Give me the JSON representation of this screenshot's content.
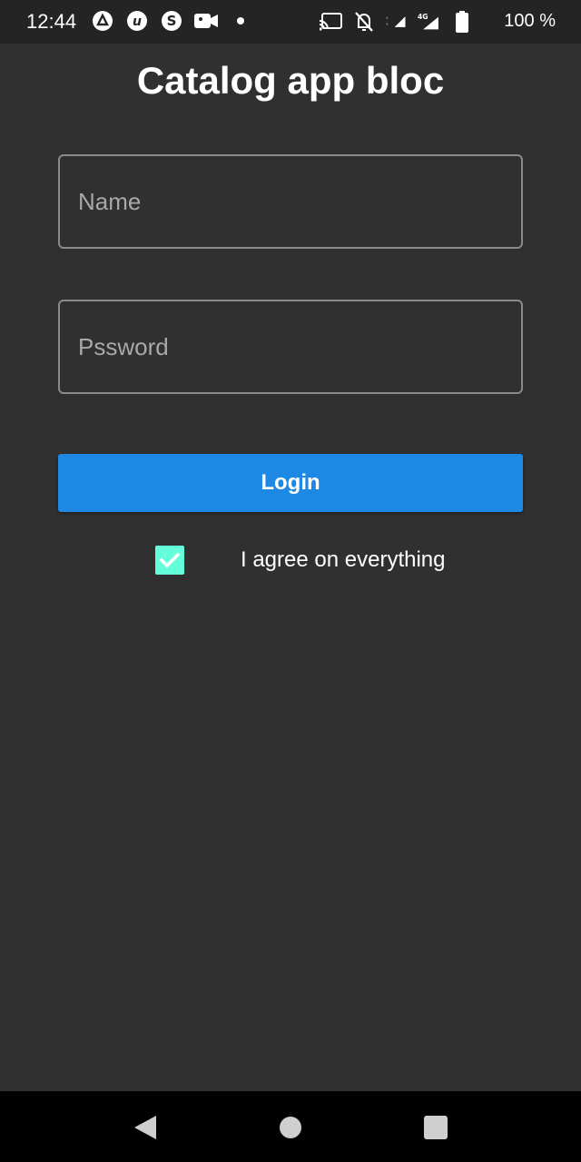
{
  "status_bar": {
    "time": "12:44",
    "battery": "100 %",
    "network": "4G",
    "icons_left": [
      "app-a-icon",
      "app-u-icon",
      "skype-icon",
      "video-icon",
      "dot-icon"
    ],
    "icons_right": [
      "cast-icon",
      "bell-off-icon",
      "signal-icon",
      "lte-signal-icon",
      "battery-icon"
    ]
  },
  "app": {
    "title": "Catalog app bloc"
  },
  "form": {
    "name_placeholder": "Name",
    "name_value": "",
    "password_placeholder": "Pssword",
    "password_value": "",
    "login_label": "Login",
    "agree_label": "I agree on everything",
    "agree_checked": true
  },
  "colors": {
    "background": "#303030",
    "accent": "#1e88e5",
    "checkbox": "#64ffda"
  }
}
